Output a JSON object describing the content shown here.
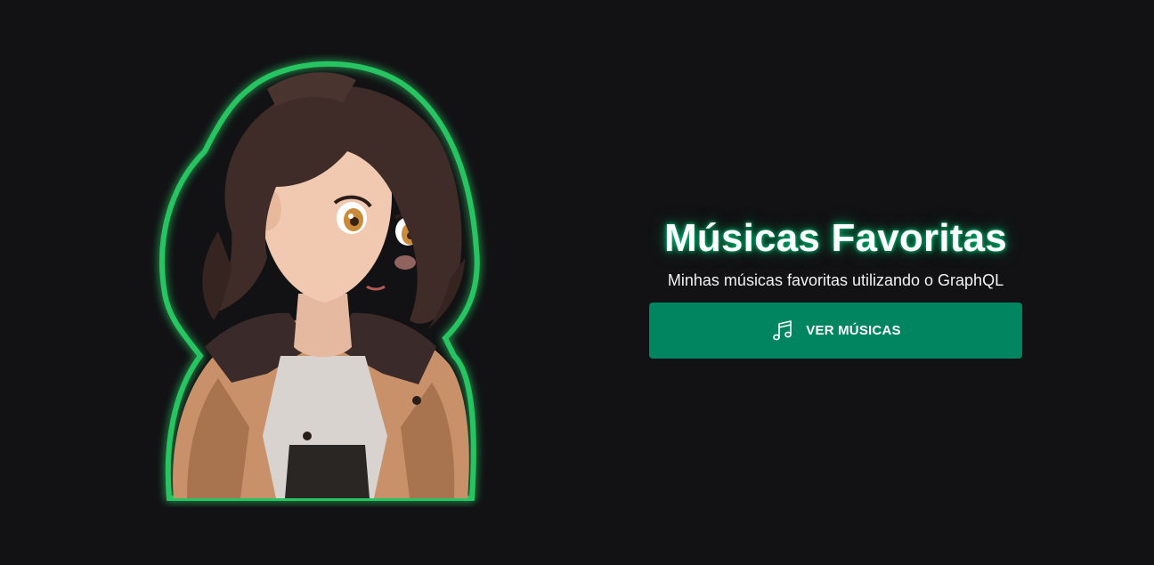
{
  "hero": {
    "title": "Músicas Favoritas",
    "subtitle": "Minhas músicas favoritas utilizando o GraphQL",
    "button_label": "VER MÚSICAS",
    "button_icon": "music-note-icon",
    "illustration": "anime-girl-illustration"
  },
  "colors": {
    "background": "#121214",
    "accent": "#008561",
    "glow": "#00c878"
  }
}
